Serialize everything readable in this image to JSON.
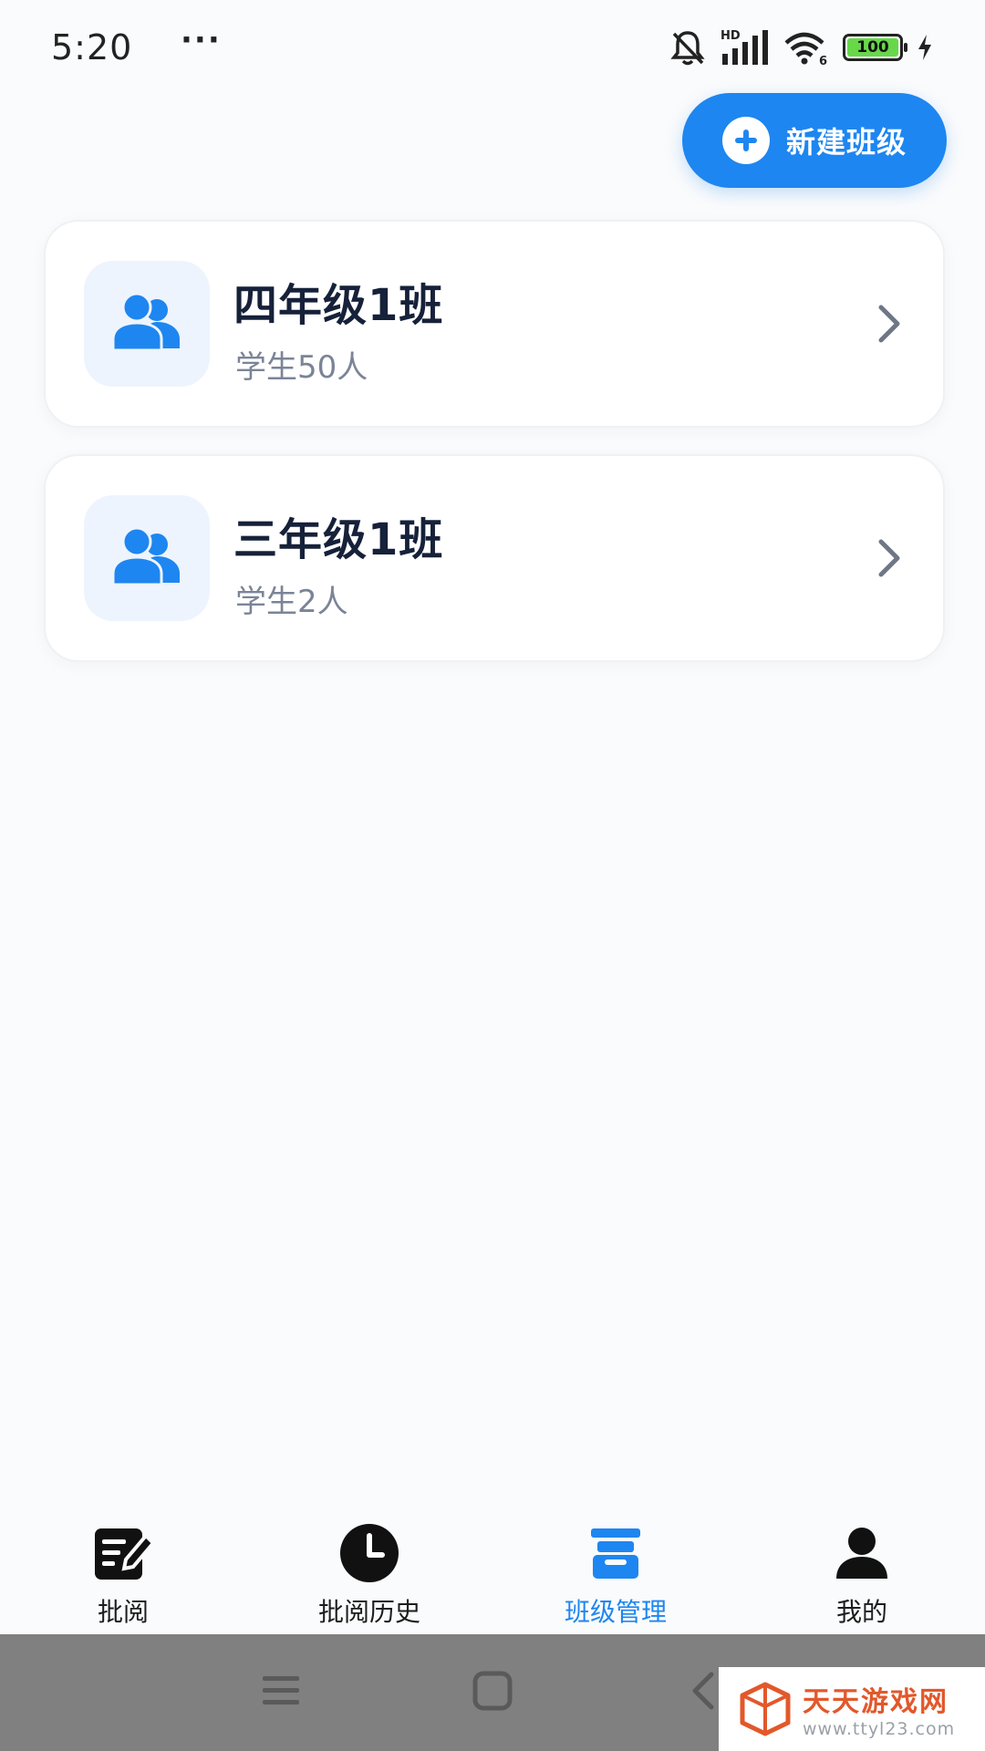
{
  "status_bar": {
    "time": "5:20",
    "more": "···",
    "network": "HD",
    "wifi_badge": "6",
    "battery": "100",
    "battery_color": "#67d84a"
  },
  "toolbar": {
    "new_class_label": "新建班级",
    "accent_color": "#1e86f0"
  },
  "classes": [
    {
      "name": "四年级1班",
      "count": "学生50人",
      "icon": "group-icon"
    },
    {
      "name": "三年级1班",
      "count": "学生2人",
      "icon": "group-icon"
    }
  ],
  "tabs": [
    {
      "label": "批阅",
      "icon": "edit-note-icon",
      "active": false
    },
    {
      "label": "批阅历史",
      "icon": "clock-icon",
      "active": false
    },
    {
      "label": "班级管理",
      "icon": "class-manage-icon",
      "active": true
    },
    {
      "label": "我的",
      "icon": "person-icon",
      "active": false
    }
  ],
  "system_nav": {
    "buttons": [
      "menu-icon",
      "home-icon",
      "back-icon"
    ]
  },
  "watermark": {
    "title": "天天游戏网",
    "url": "www.ttyl23.com"
  }
}
